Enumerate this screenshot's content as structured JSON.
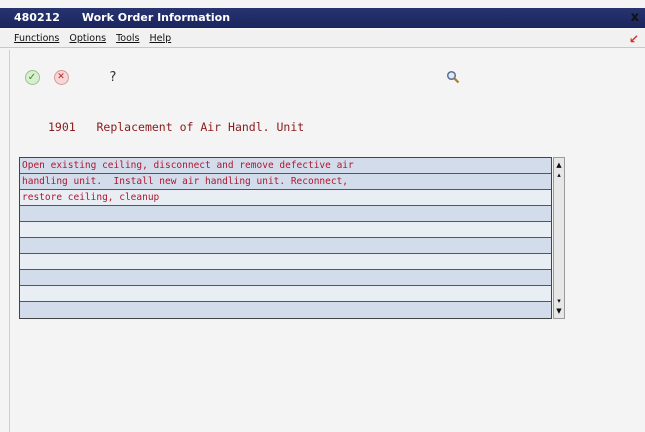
{
  "window": {
    "code": "480212",
    "title": "Work Order Information",
    "close_glyph": "x"
  },
  "menu": [
    {
      "label": "Functions"
    },
    {
      "label": "Options"
    },
    {
      "label": "Tools"
    },
    {
      "label": "Help"
    }
  ],
  "toolbar": {
    "ok_glyph": "✓",
    "cancel_glyph": "✕",
    "help_glyph": "?",
    "ok_icon": "ok-icon",
    "cancel_icon": "cancel-icon",
    "help_icon": "help-icon",
    "search_icon": "search-icon"
  },
  "work_order": {
    "number": "1901",
    "description": "Replacement of Air Handl. Unit"
  },
  "grid": {
    "rows": [
      "Open existing ceiling, disconnect and remove defective air",
      "handling unit.  Install new air handling unit. Reconnect,",
      "restore ceiling, cleanup",
      "",
      "",
      "",
      "",
      "",
      "",
      ""
    ]
  },
  "colors": {
    "title_bar": "#1a2560",
    "text_red": "#b0172e",
    "row_shade": "#d3dceb"
  }
}
